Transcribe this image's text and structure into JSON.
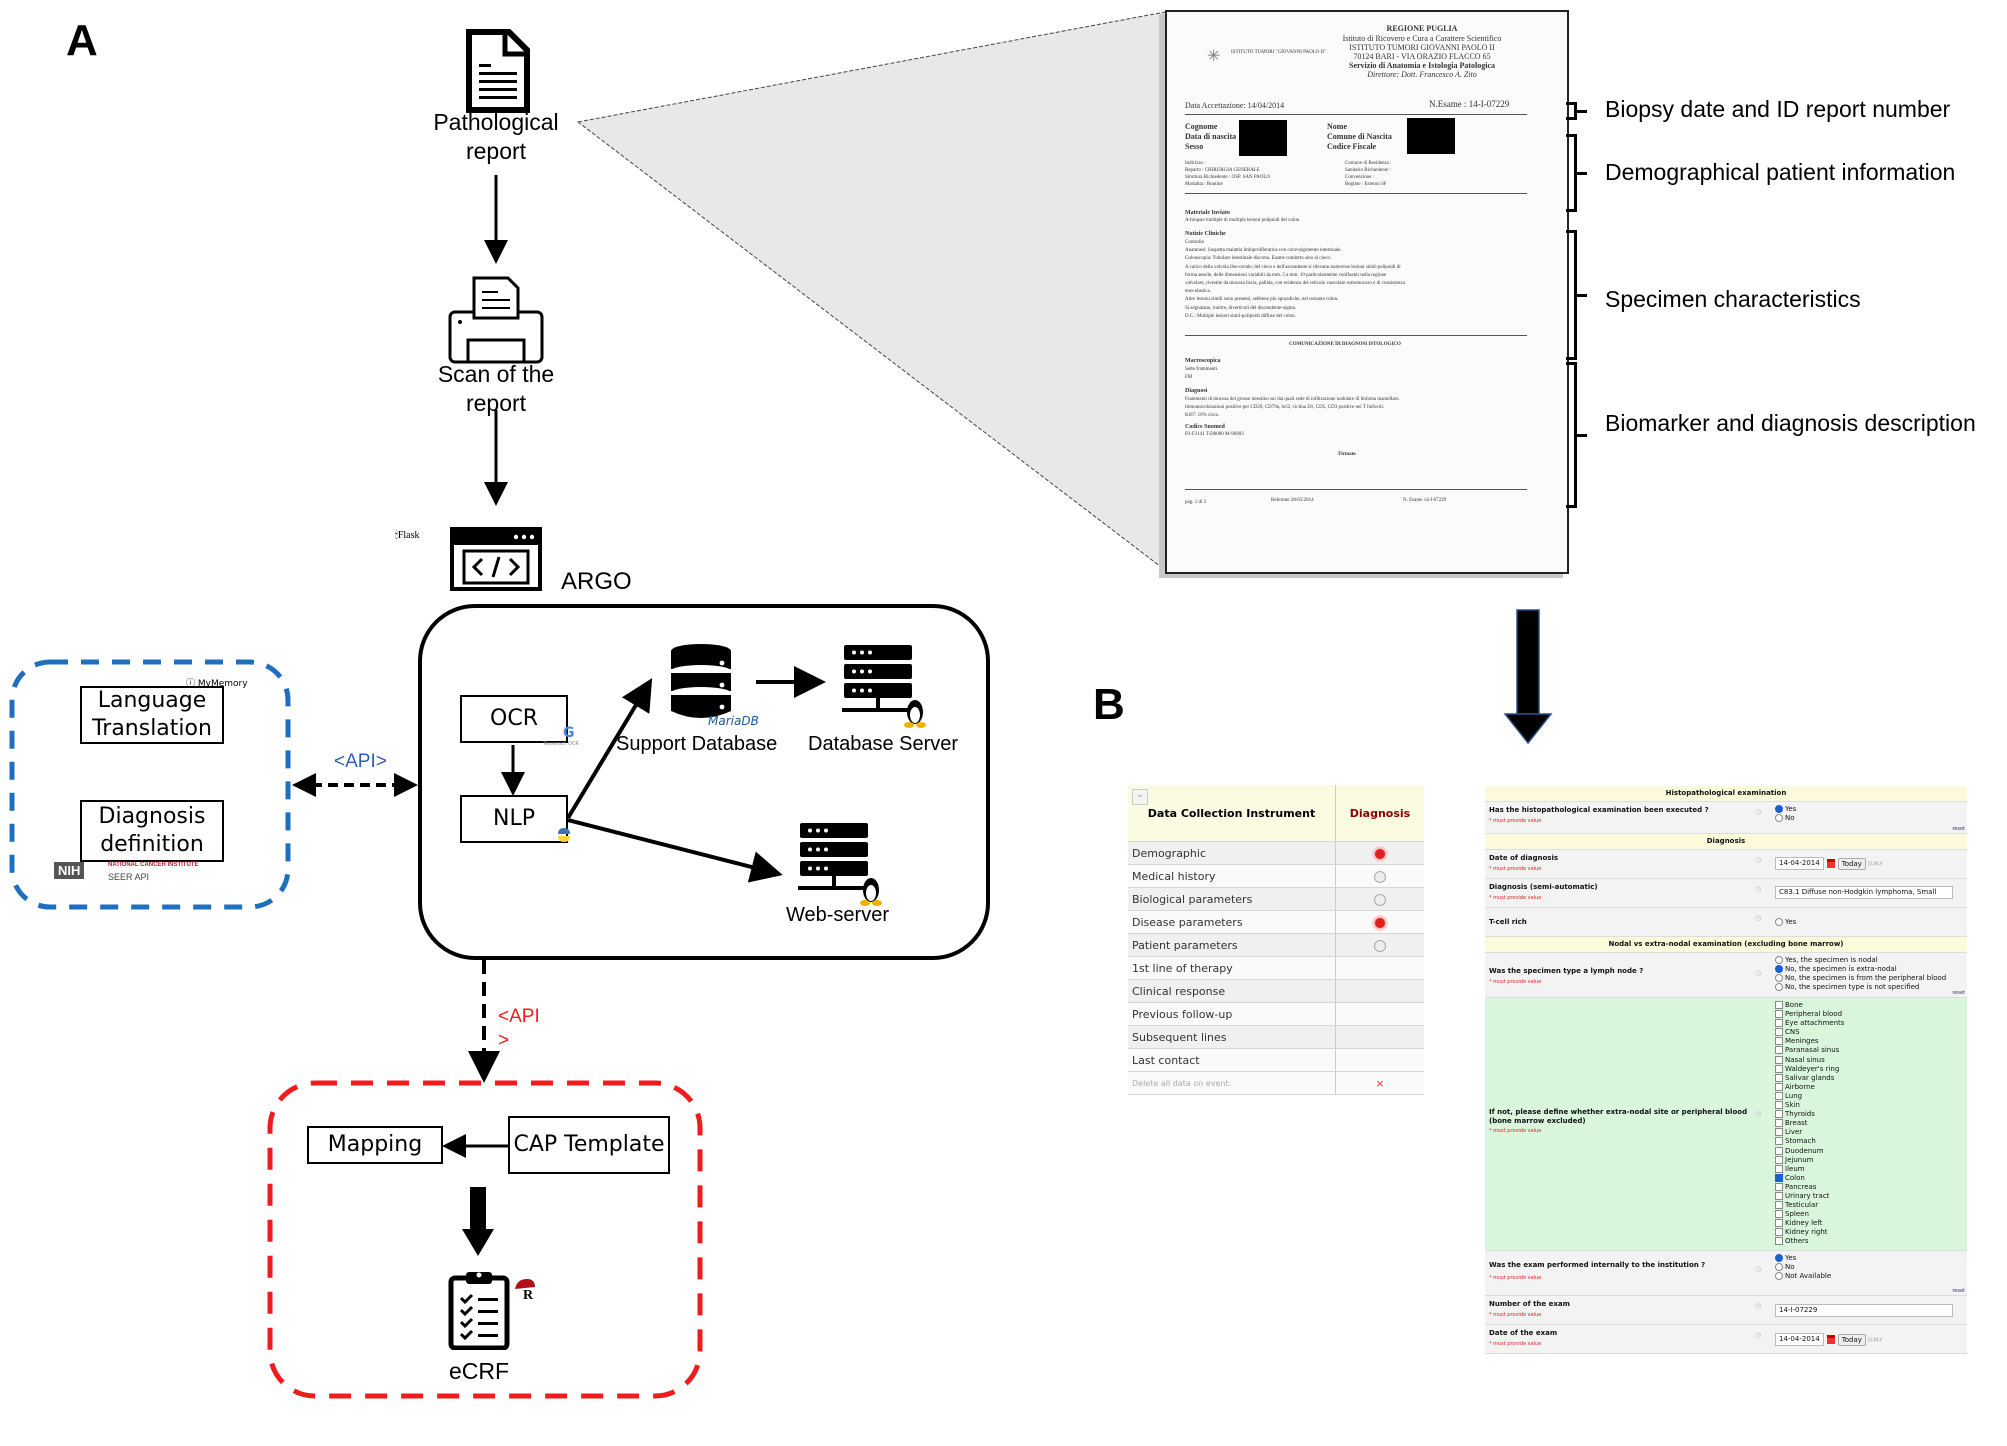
{
  "panels": {
    "a_label": "A",
    "b_label": "B"
  },
  "workflow": {
    "pathological_report": "Pathological report",
    "scan": "Scan of  the report",
    "argo": "ARGO",
    "flask": "Flask",
    "ocr": "OCR",
    "ocr_tool": "Tesseract OCR",
    "nlp": "NLP",
    "support_db": "Support Database",
    "mariadb": "MariaDB",
    "db_server": "Database Server",
    "web_server": "Web-server",
    "api_blue": "<API>",
    "api_red_1": "<API",
    "api_red_2": ">"
  },
  "external_services": {
    "language_translation": "Language Translation",
    "mymemory": "MyMemory",
    "diagnosis_definition": "Diagnosis definition",
    "nih": "NIH",
    "nci": "NATIONAL CANCER INSTITUTE",
    "seer": "SEER API"
  },
  "redcap": {
    "mapping": "Mapping",
    "cap_template": "CAP Template",
    "ecrf": "eCRF"
  },
  "colors": {
    "blue_dash": "#1f6fc1",
    "red_dash": "#ee1c1c",
    "api_blue": "#2d5fb8",
    "api_red": "#ee1c1c"
  },
  "report": {
    "header": [
      "REGIONE PUGLIA",
      "Istituto di Ricovero e Cura a Carattere Scientifico",
      "ISTITUTO TUMORI GIOVANNI PAOLO II",
      "70124 BARI - VIA ORAZIO FLACCO 65",
      "Servizio di Anatomia e Istologia Patologica",
      "Direttore: Dott. Francesco A. Zito"
    ],
    "institute": "ISTITUTO TUMORI \"GIOVANNI PAOLO II\"",
    "date_accept": "Data Accettazione: 14/04/2014",
    "exam_no": "N.Esame : 14-I-07229",
    "left_fields": [
      "Cognome",
      "Data di nascita",
      "Sesso"
    ],
    "right_fields": [
      "Nome",
      "Comune di Nascita",
      "Codice Fiscale"
    ],
    "left_info": [
      "Indirizzo :",
      "Reparto : CHIRURGIA GENERALE",
      "Struttura Richiedente : OSP. SAN PAOLO",
      "Modalita : Routine"
    ],
    "right_info": [
      "Comune di Residenza :",
      "Sanitario Richiedente :",
      "Convenzione :",
      "Regime : Esterno SF"
    ],
    "materiale_title": "Materiale Inviato",
    "materiale": "A-biopsie multiple di multiple lesioni polipoidi del colon",
    "notizie_title": "Notizie Cliniche",
    "notizie": [
      "Controllo",
      "Anamnesi: Sospetta malattia linfoproliferativa con coinvolgimento intestinale.",
      "Colonscopia: Tubulare intestinale discreta. Esame condotto sino al cieco.",
      "A carico della valvola ileo-cecale, del cieco e dell'ascendente si rilevano numerose lesioni simil-polipoidi di",
      "forma sessile, delle dimensioni variabili da mm. 5 a mm. 10 particolarmente confluenti nella regione",
      "valvolare, rivestite da mucosa liscia, pallida, con evidenza del reticolo vascolare sottomucoso e di consistenza",
      "teso-elastica.",
      "Altre lesioni simili sono presenti, sebbene piu sporadiche, nel restante colon.",
      "Si segnalano, inoltre, diverticoli del discendente-sigma.",
      "D.C.: Multiple lesioni simil-polipoidi diffuse del colon."
    ],
    "comunicazione": "COMUNICAZIONE DI DIAGNOSI ISTOLOGICO",
    "macro_title": "Macroscopica",
    "macro": [
      "Sette frammenti.",
      "FM"
    ],
    "diagnosi_title": "Diagnosi",
    "diagnosi": [
      "Frammenti di mucosa del grosso intestino sui dai quali sede di infiltrazione nodulare di linfoma mantellare.",
      "Immunocolorazioni positive per CD20, CD79a, bcl2, ciclina D1, CD5, CD3 positive nei T linfociti.",
      "Ki67: 10% circa."
    ],
    "codice_title": "Codice Snomed",
    "codice": "P3-F2141    T-D0000    M-96903",
    "firmato": "Firmato",
    "footer_left": "pag. 1 di 2",
    "footer_mid": "Refertato 28/05/2014",
    "footer_right": "N. Esame 14-I-07229"
  },
  "annotations": [
    "Biopsy date and ID report number",
    "Demographical patient information",
    "Specimen characteristics",
    "Biomarker and diagnosis  description"
  ],
  "instrument_table": {
    "header_col1": "Data Collection Instrument",
    "header_col2": "Diagnosis",
    "rows": [
      {
        "name": "Demographic",
        "status": "incomplete"
      },
      {
        "name": "Medical history",
        "status": "empty"
      },
      {
        "name": "Biological parameters",
        "status": "empty"
      },
      {
        "name": "Disease parameters",
        "status": "incomplete"
      },
      {
        "name": "Patient parameters",
        "status": "empty"
      },
      {
        "name": "1st line of therapy",
        "status": ""
      },
      {
        "name": "Clinical response",
        "status": ""
      },
      {
        "name": "Previous follow-up",
        "status": ""
      },
      {
        "name": "Subsequent lines",
        "status": ""
      },
      {
        "name": "Last contact",
        "status": ""
      }
    ],
    "delete_label": "Delete all data on event:",
    "delete_icon": "×"
  },
  "form": {
    "sec_histo": "Histopathological examination",
    "q_histo": "Has the histopathological examination been executed ?",
    "must": "* must provide value",
    "yes": "Yes",
    "no": "No",
    "reset": "reset",
    "sec_diag": "Diagnosis",
    "q_date_diag": "Date of diagnosis",
    "date_diag_val": "14-04-2014",
    "today": "Today",
    "fmt": "D-M-Y",
    "q_diag_semi": "Diagnosis (semi-automatic)",
    "diag_val": "C83.1 Diffuse non-Hodgkin lymphoma, Small",
    "q_tcell": "T-cell rich",
    "sec_nodal": "Nodal vs extra-nodal examination (excluding bone marrow)",
    "q_lymph": "Was the specimen type a lymph node ?",
    "lymph_opts": [
      "Yes, the specimen is nodal",
      "No, the specimen is extra-nodal",
      "No, the specimen is from the peripheral blood",
      "No, the specimen type is not specified"
    ],
    "lymph_selected": 1,
    "q_site": "If not, please define whether extra-nodal site or peripheral blood (bone marrow excluded)",
    "sites": [
      "Bone",
      "Peripheral blood",
      "Eye attachments",
      "CNS",
      "Meninges",
      "Paranasal sinus",
      "Nasal sinus",
      "Waldeyer's ring",
      "Salivar glands",
      "Airborne",
      "Lung",
      "Skin",
      "Thyroids",
      "Breast",
      "Liver",
      "Stomach",
      "Duodenum",
      "Jejunum",
      "Ileum",
      "Colon",
      "Pancreas",
      "Urinary tract",
      "Testicular",
      "Spleen",
      "Kidney left",
      "Kidney right",
      "Others"
    ],
    "sites_checked": [
      "Colon"
    ],
    "q_internal": "Was the exam performed internally to the institution ?",
    "internal_opts": [
      "Yes",
      "No",
      "Not Available"
    ],
    "internal_selected": 0,
    "q_exam_no": "Number of the exam",
    "exam_no_val": "14-I-07229",
    "q_exam_date": "Date of the exam",
    "exam_date_val": "14-04-2014"
  }
}
